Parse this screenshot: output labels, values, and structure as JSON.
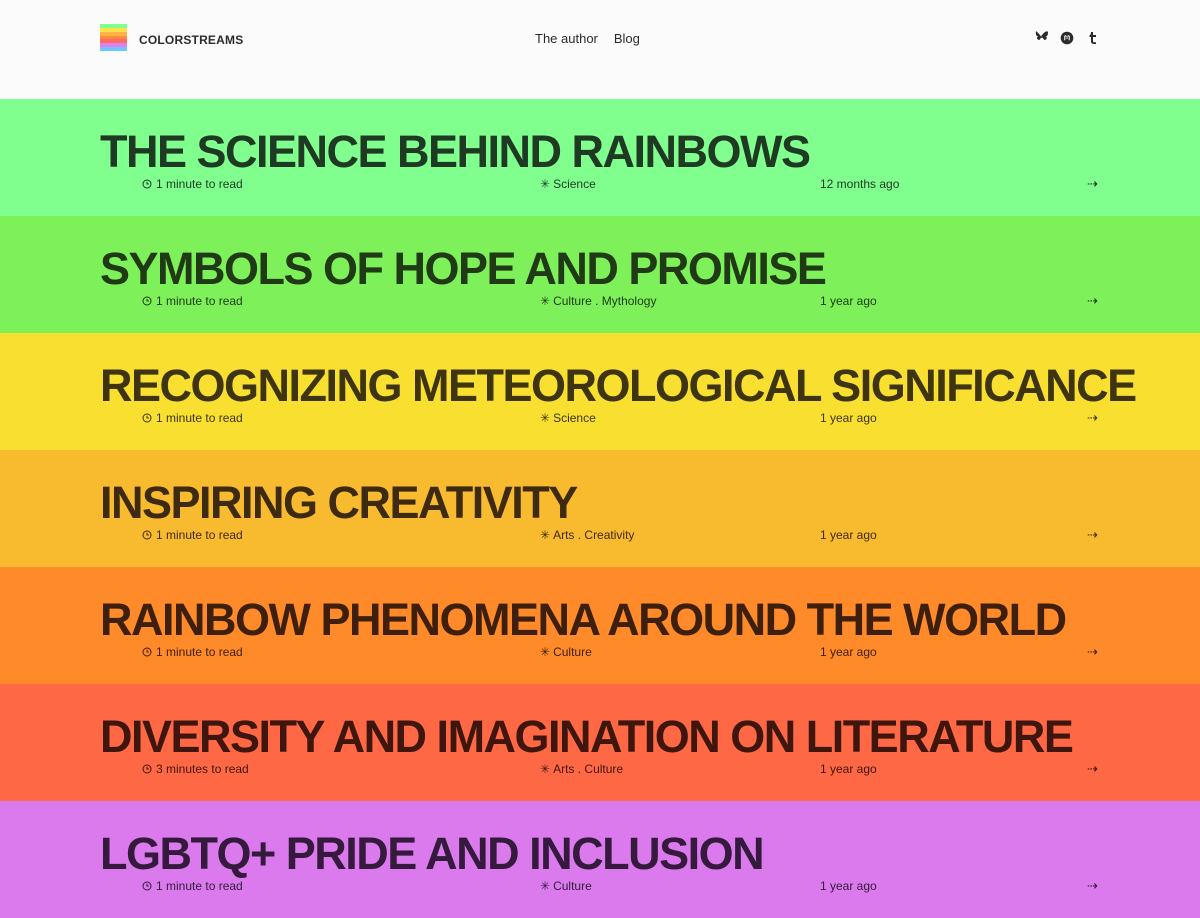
{
  "site": {
    "name": "COLORSTREAMS",
    "logo_colors": [
      "#7fff8e",
      "#ffe24a",
      "#ffb347",
      "#ff8c42",
      "#ff6b5e",
      "#e07ff0",
      "#6ec6ff"
    ]
  },
  "nav": {
    "author": "The author",
    "blog": "Blog"
  },
  "social": [
    "bluesky-icon",
    "mastodon-icon",
    "tumblr-icon"
  ],
  "posts": [
    {
      "title": "THE SCIENCE BEHIND RAINBOWS",
      "read": "1 minute to read",
      "category": "Science",
      "date": "12 months ago",
      "bg": "#80ff8f",
      "fg": "#1f3a23"
    },
    {
      "title": "SYMBOLS OF HOPE AND PROMISE",
      "read": "1 minute to read",
      "category": "Culture . Mythology",
      "date": "1 year ago",
      "bg": "#7ef05a",
      "fg": "#1f3a14"
    },
    {
      "title": "RECOGNIZING METEOROLOGICAL SIGNIFICANCE",
      "read": "1 minute to read",
      "category": "Science",
      "date": "1 year ago",
      "bg": "#f8df30",
      "fg": "#3e3410"
    },
    {
      "title": "INSPIRING CREATIVITY",
      "read": "1 minute to read",
      "category": "Arts . Creativity",
      "date": "1 year ago",
      "bg": "#f8bb30",
      "fg": "#3e2a0e"
    },
    {
      "title": "RAINBOW PHENOMENA AROUND THE WORLD",
      "read": "1 minute to read",
      "category": "Culture",
      "date": "1 year ago",
      "bg": "#fe8a2a",
      "fg": "#3e1f0c"
    },
    {
      "title": "DIVERSITY AND IMAGINATION ON LITERATURE",
      "read": "3 minutes to read",
      "category": "Arts . Culture",
      "date": "1 year ago",
      "bg": "#fe6845",
      "fg": "#3e160e"
    },
    {
      "title": "LGBTQ+ PRIDE AND INCLUSION",
      "read": "1 minute to read",
      "category": "Culture",
      "date": "1 year ago",
      "bg": "#da7aec",
      "fg": "#351a3e"
    }
  ]
}
